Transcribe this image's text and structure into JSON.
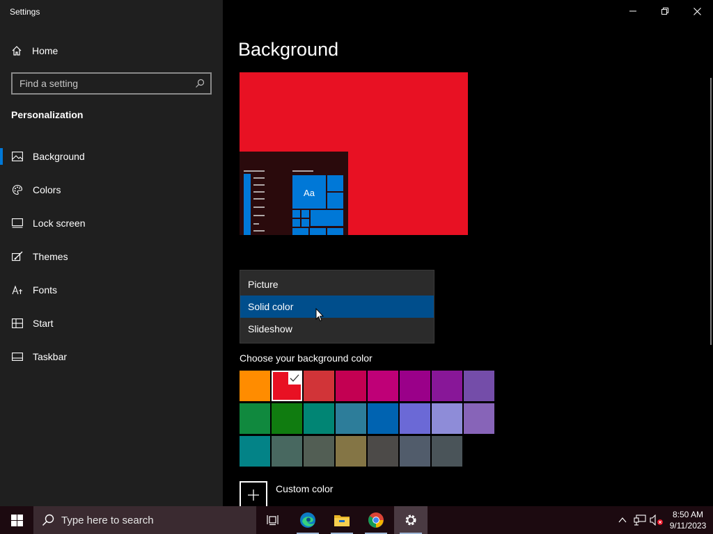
{
  "window": {
    "title": "Settings",
    "controls": {
      "minimize": "minimize",
      "maximize": "restore",
      "close": "close"
    }
  },
  "sidebar": {
    "home_label": "Home",
    "search_placeholder": "Find a setting",
    "section_title": "Personalization",
    "items": [
      {
        "label": "Background",
        "icon": "picture-icon",
        "active": true
      },
      {
        "label": "Colors",
        "icon": "palette-icon"
      },
      {
        "label": "Lock screen",
        "icon": "lock-screen-icon"
      },
      {
        "label": "Themes",
        "icon": "brush-icon"
      },
      {
        "label": "Fonts",
        "icon": "font-icon"
      },
      {
        "label": "Start",
        "icon": "start-icon"
      },
      {
        "label": "Taskbar",
        "icon": "taskbar-icon"
      }
    ]
  },
  "main": {
    "page_title": "Background",
    "preview": {
      "tile_label": "Aa",
      "background_color": "#e81123"
    },
    "background_dropdown": {
      "options": [
        "Picture",
        "Solid color",
        "Slideshow"
      ],
      "selected": "Solid color"
    },
    "color_label": "Choose your background color",
    "colors": [
      "#ff8c00",
      "#e81123",
      "#d13438",
      "#c30052",
      "#bf0077",
      "#9a0089",
      "#881798",
      "#744da9",
      "#10893e",
      "#107c10",
      "#018574",
      "#2d7d9a",
      "#0063b1",
      "#6b69d6",
      "#8e8cd8",
      "#8764b8",
      "#038387",
      "#486860",
      "#525e54",
      "#847545",
      "#4c4a48",
      "#515c6b",
      "#4a5459"
    ],
    "selected_color": "#e81123",
    "custom_color_label": "Custom color"
  },
  "taskbar": {
    "search_placeholder": "Type here to search",
    "apps": [
      "task-view-icon",
      "edge-icon",
      "file-explorer-icon",
      "chrome-icon",
      "settings-icon"
    ],
    "time": "8:50 AM",
    "date": "9/11/2023",
    "accent": "#0078d7"
  }
}
